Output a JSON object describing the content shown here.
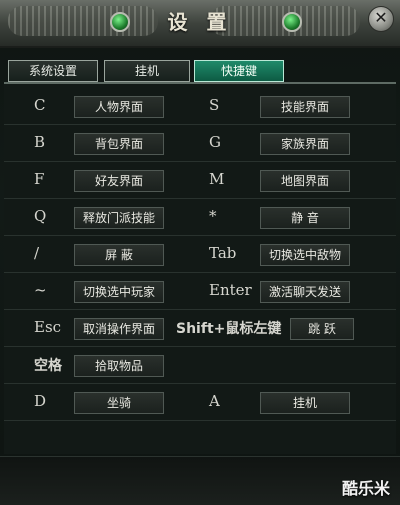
{
  "window": {
    "title": "设 置",
    "close_symbol": "✕"
  },
  "tabs": [
    {
      "label": "系统设置",
      "active": false
    },
    {
      "label": "挂机",
      "active": false
    },
    {
      "label": "快捷键",
      "active": true
    }
  ],
  "shortcuts": [
    {
      "left_key": "C",
      "left_action": "人物界面",
      "right_key": "S",
      "right_action": "技能界面"
    },
    {
      "left_key": "B",
      "left_action": "背包界面",
      "right_key": "G",
      "right_action": "家族界面"
    },
    {
      "left_key": "F",
      "left_action": "好友界面",
      "right_key": "M",
      "right_action": "地图界面"
    },
    {
      "left_key": "Q",
      "left_action": "释放门派技能",
      "right_key": "*",
      "right_action": "静 音"
    },
    {
      "left_key": "/",
      "left_action": "屏 蔽",
      "right_key": "Tab",
      "right_action": "切换选中敌物"
    },
    {
      "left_key": "~",
      "left_action": "切换选中玩家",
      "right_key": "Enter",
      "right_action": "激活聊天发送"
    },
    {
      "left_key": "Esc",
      "left_action": "取消操作界面",
      "right_key": "Shift+鼠标左键",
      "right_action": "跳 跃"
    },
    {
      "left_key": "空格",
      "left_action": "拾取物品",
      "right_key": "",
      "right_action": ""
    },
    {
      "left_key": "D",
      "left_action": "坐骑",
      "right_key": "A",
      "right_action": "挂机"
    }
  ],
  "watermark": "酷乐米"
}
